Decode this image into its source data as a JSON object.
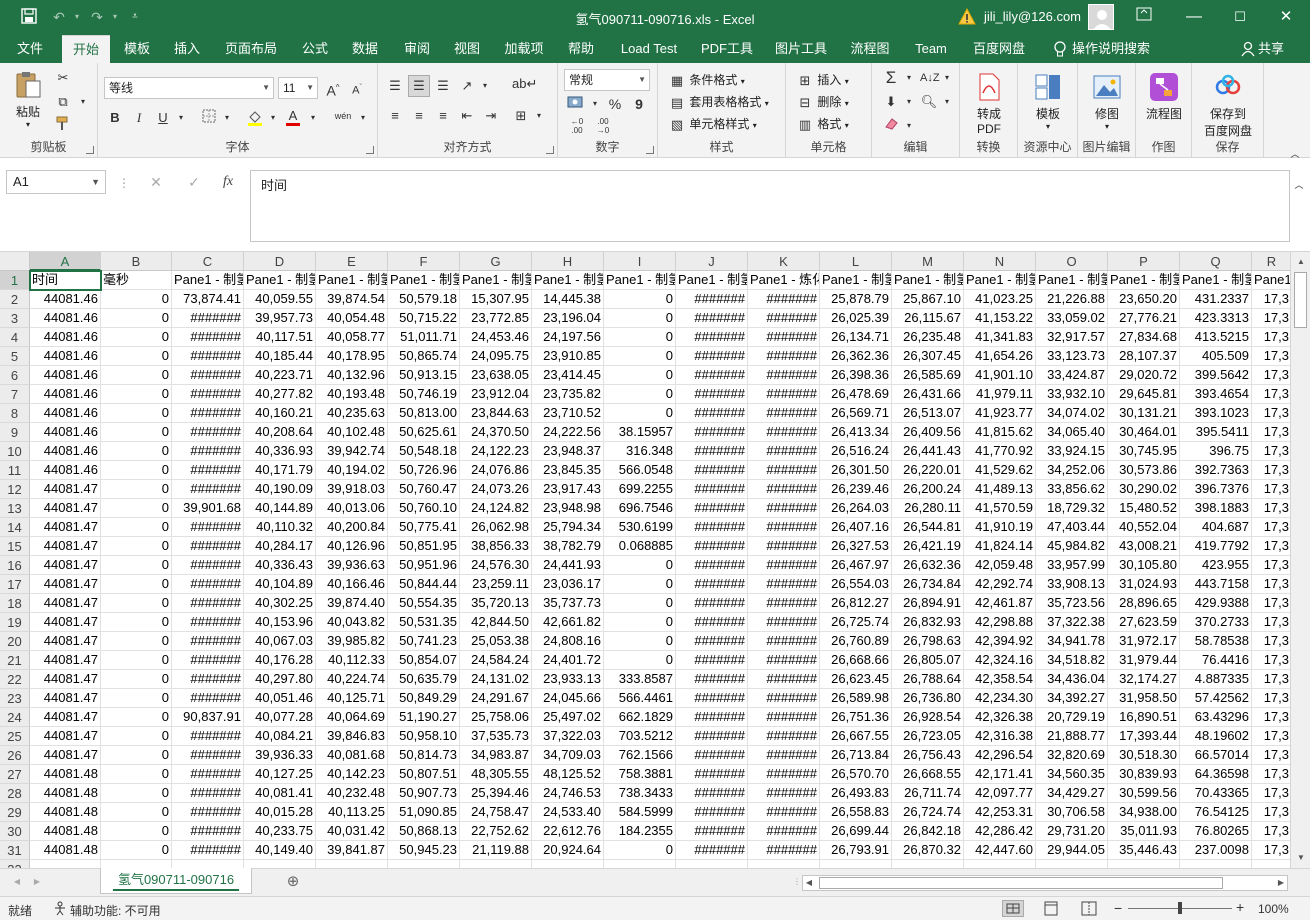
{
  "window": {
    "title": "氢气090711-090716.xls  -  Excel",
    "user": "jili_lily@126.com",
    "icons": [
      "save-icon",
      "undo-icon",
      "redo-icon",
      "customize-qat-icon",
      "warning-icon",
      "avatar",
      "minimize-icon",
      "restore-icon",
      "maximize-icon",
      "close-icon"
    ]
  },
  "tabs": [
    "文件",
    "开始",
    "模板",
    "插入",
    "页面布局",
    "公式",
    "数据",
    "审阅",
    "视图",
    "加载项",
    "帮助",
    "Load Test",
    "PDF工具",
    "图片工具",
    "流程图",
    "Team",
    "百度网盘",
    "操作说明搜索",
    "共享"
  ],
  "ribbon": {
    "clipboard": {
      "paste": "粘贴",
      "label": "剪贴板"
    },
    "font": {
      "name": "等线",
      "size": "11",
      "bold": "B",
      "italic": "I",
      "underline": "U",
      "grow": "A",
      "shrink": "A",
      "font_color": "A",
      "pinyin": "wén",
      "label": "字体"
    },
    "alignment": {
      "label": "对齐方式"
    },
    "number": {
      "format": "常规",
      "percent": "%",
      "comma": "9",
      "label": "数字"
    },
    "styles": {
      "conditional": "条件格式",
      "table": "套用表格格式",
      "cell": "单元格样式",
      "label": "样式"
    },
    "cells": {
      "insert": "插入",
      "delete": "删除",
      "format": "格式",
      "label": "单元格"
    },
    "editing": {
      "label": "编辑"
    },
    "pdf": {
      "btn": "转成\nPDF",
      "btn1": "转成",
      "btn2": "PDF",
      "label": "转换"
    },
    "template": {
      "btn": "模板",
      "label": "资源中心"
    },
    "image": {
      "btn": "修图",
      "label": "图片编辑"
    },
    "flow": {
      "btn": "流程图",
      "label": "作图"
    },
    "save": {
      "btn1": "保存到",
      "btn2": "百度网盘",
      "label": "保存"
    }
  },
  "formula_bar": {
    "namebox": "A1",
    "cancel": "✕",
    "enter": "✓",
    "fx": "fx",
    "content": "时间"
  },
  "columns": [
    "A",
    "B",
    "C",
    "D",
    "E",
    "F",
    "G",
    "H",
    "I",
    "J",
    "K",
    "L",
    "M",
    "N",
    "O",
    "P",
    "Q",
    "R"
  ],
  "header_row": [
    "时间",
    "毫秒",
    "Pane1 - 制氢",
    "Pane1 - 制氢",
    "Pane1 - 制氢",
    "Pane1 - 制氢",
    "Pane1 - 制氢",
    "Pane1 - 制氢",
    "Pane1 - 制氢",
    "Pane1 - 制氢",
    "Pane1 - 炼化",
    "Pane1 - 制氢",
    "Pane1 - 制氢",
    "Pane1 - 制氢",
    "Pane1 - 制氢",
    "Pane1 - 制氢",
    "Pane1 - 制氢",
    "Pane1"
  ],
  "rows": [
    [
      "44081.46",
      "0",
      "73,874.41",
      "40,059.55",
      "39,874.54",
      "50,579.18",
      "15,307.95",
      "14,445.38",
      "0",
      "#######",
      "#######",
      "25,878.79",
      "25,867.10",
      "41,023.25",
      "21,226.88",
      "23,650.20",
      "431.2337",
      "17,3"
    ],
    [
      "44081.46",
      "0",
      "#######",
      "39,957.73",
      "40,054.48",
      "50,715.22",
      "23,772.85",
      "23,196.04",
      "0",
      "#######",
      "#######",
      "26,025.39",
      "26,115.67",
      "41,153.22",
      "33,059.02",
      "27,776.21",
      "423.3313",
      "17,3"
    ],
    [
      "44081.46",
      "0",
      "#######",
      "40,117.51",
      "40,058.77",
      "51,011.71",
      "24,453.46",
      "24,197.56",
      "0",
      "#######",
      "#######",
      "26,134.71",
      "26,235.48",
      "41,341.83",
      "32,917.57",
      "27,834.68",
      "413.5215",
      "17,3"
    ],
    [
      "44081.46",
      "0",
      "#######",
      "40,185.44",
      "40,178.95",
      "50,865.74",
      "24,095.75",
      "23,910.85",
      "0",
      "#######",
      "#######",
      "26,362.36",
      "26,307.45",
      "41,654.26",
      "33,123.73",
      "28,107.37",
      "405.509",
      "17,3"
    ],
    [
      "44081.46",
      "0",
      "#######",
      "40,223.71",
      "40,132.96",
      "50,913.15",
      "23,638.05",
      "23,414.45",
      "0",
      "#######",
      "#######",
      "26,398.36",
      "26,585.69",
      "41,901.10",
      "33,424.87",
      "29,020.72",
      "399.5642",
      "17,3"
    ],
    [
      "44081.46",
      "0",
      "#######",
      "40,277.82",
      "40,193.48",
      "50,746.19",
      "23,912.04",
      "23,735.82",
      "0",
      "#######",
      "#######",
      "26,478.69",
      "26,431.66",
      "41,979.11",
      "33,932.10",
      "29,645.81",
      "393.4654",
      "17,3"
    ],
    [
      "44081.46",
      "0",
      "#######",
      "40,160.21",
      "40,235.63",
      "50,813.00",
      "23,844.63",
      "23,710.52",
      "0",
      "#######",
      "#######",
      "26,569.71",
      "26,513.07",
      "41,923.77",
      "34,074.02",
      "30,131.21",
      "393.1023",
      "17,3"
    ],
    [
      "44081.46",
      "0",
      "#######",
      "40,208.64",
      "40,102.48",
      "50,625.61",
      "24,370.50",
      "24,222.56",
      "38.15957",
      "#######",
      "#######",
      "26,413.34",
      "26,409.56",
      "41,815.62",
      "34,065.40",
      "30,464.01",
      "395.5411",
      "17,3"
    ],
    [
      "44081.46",
      "0",
      "#######",
      "40,336.93",
      "39,942.74",
      "50,548.18",
      "24,122.23",
      "23,948.37",
      "316.348",
      "#######",
      "#######",
      "26,516.24",
      "26,441.43",
      "41,770.92",
      "33,924.15",
      "30,745.95",
      "396.75",
      "17,3"
    ],
    [
      "44081.46",
      "0",
      "#######",
      "40,171.79",
      "40,194.02",
      "50,726.96",
      "24,076.86",
      "23,845.35",
      "566.0548",
      "#######",
      "#######",
      "26,301.50",
      "26,220.01",
      "41,529.62",
      "34,252.06",
      "30,573.86",
      "392.7363",
      "17,3"
    ],
    [
      "44081.47",
      "0",
      "#######",
      "40,190.09",
      "39,918.03",
      "50,760.47",
      "24,073.26",
      "23,917.43",
      "699.2255",
      "#######",
      "#######",
      "26,239.46",
      "26,200.24",
      "41,489.13",
      "33,856.62",
      "30,290.02",
      "396.7376",
      "17,3"
    ],
    [
      "44081.47",
      "0",
      "39,901.68",
      "40,144.89",
      "40,013.06",
      "50,760.10",
      "24,124.82",
      "23,948.98",
      "696.7546",
      "#######",
      "#######",
      "26,264.03",
      "26,280.11",
      "41,570.59",
      "18,729.32",
      "15,480.52",
      "398.1883",
      "17,3"
    ],
    [
      "44081.47",
      "0",
      "#######",
      "40,110.32",
      "40,200.84",
      "50,775.41",
      "26,062.98",
      "25,794.34",
      "530.6199",
      "#######",
      "#######",
      "26,407.16",
      "26,544.81",
      "41,910.19",
      "47,403.44",
      "40,552.04",
      "404.687",
      "17,3"
    ],
    [
      "44081.47",
      "0",
      "#######",
      "40,284.17",
      "40,126.96",
      "50,851.95",
      "38,856.33",
      "38,782.79",
      "0.068885",
      "#######",
      "#######",
      "26,327.53",
      "26,421.19",
      "41,824.14",
      "45,984.82",
      "43,008.21",
      "419.7792",
      "17,3"
    ],
    [
      "44081.47",
      "0",
      "#######",
      "40,336.43",
      "39,936.63",
      "50,951.96",
      "24,576.30",
      "24,441.93",
      "0",
      "#######",
      "#######",
      "26,467.97",
      "26,632.36",
      "42,059.48",
      "33,957.99",
      "30,105.80",
      "423.955",
      "17,3"
    ],
    [
      "44081.47",
      "0",
      "#######",
      "40,104.89",
      "40,166.46",
      "50,844.44",
      "23,259.11",
      "23,036.17",
      "0",
      "#######",
      "#######",
      "26,554.03",
      "26,734.84",
      "42,292.74",
      "33,908.13",
      "31,024.93",
      "443.7158",
      "17,3"
    ],
    [
      "44081.47",
      "0",
      "#######",
      "40,302.25",
      "39,874.40",
      "50,554.35",
      "35,720.13",
      "35,737.73",
      "0",
      "#######",
      "#######",
      "26,812.27",
      "26,894.91",
      "42,461.87",
      "35,723.56",
      "28,896.65",
      "429.9388",
      "17,3"
    ],
    [
      "44081.47",
      "0",
      "#######",
      "40,153.96",
      "40,043.82",
      "50,531.35",
      "42,844.50",
      "42,661.82",
      "0",
      "#######",
      "#######",
      "26,725.74",
      "26,832.93",
      "42,298.88",
      "37,322.38",
      "27,623.59",
      "370.2733",
      "17,3"
    ],
    [
      "44081.47",
      "0",
      "#######",
      "40,067.03",
      "39,985.82",
      "50,741.23",
      "25,053.38",
      "24,808.16",
      "0",
      "#######",
      "#######",
      "26,760.89",
      "26,798.63",
      "42,394.92",
      "34,941.78",
      "31,972.17",
      "58.78538",
      "17,3"
    ],
    [
      "44081.47",
      "0",
      "#######",
      "40,176.28",
      "40,112.33",
      "50,854.07",
      "24,584.24",
      "24,401.72",
      "0",
      "#######",
      "#######",
      "26,668.66",
      "26,805.07",
      "42,324.16",
      "34,518.82",
      "31,979.44",
      "76.4416",
      "17,3"
    ],
    [
      "44081.47",
      "0",
      "#######",
      "40,297.80",
      "40,224.74",
      "50,635.79",
      "24,131.02",
      "23,933.13",
      "333.8587",
      "#######",
      "#######",
      "26,623.45",
      "26,788.64",
      "42,358.54",
      "34,436.04",
      "32,174.27",
      "4.887335",
      "17,3"
    ],
    [
      "44081.47",
      "0",
      "#######",
      "40,051.46",
      "40,125.71",
      "50,849.29",
      "24,291.67",
      "24,045.66",
      "566.4461",
      "#######",
      "#######",
      "26,589.98",
      "26,736.80",
      "42,234.30",
      "34,392.27",
      "31,958.50",
      "57.42562",
      "17,3"
    ],
    [
      "44081.47",
      "0",
      "90,837.91",
      "40,077.28",
      "40,064.69",
      "51,190.27",
      "25,758.06",
      "25,497.02",
      "662.1829",
      "#######",
      "#######",
      "26,751.36",
      "26,928.54",
      "42,326.38",
      "20,729.19",
      "16,890.51",
      "63.43296",
      "17,3"
    ],
    [
      "44081.47",
      "0",
      "#######",
      "40,084.21",
      "39,846.83",
      "50,958.10",
      "37,535.73",
      "37,322.03",
      "703.5212",
      "#######",
      "#######",
      "26,667.55",
      "26,723.05",
      "42,316.38",
      "21,888.77",
      "17,393.44",
      "48.19602",
      "17,3"
    ],
    [
      "44081.47",
      "0",
      "#######",
      "39,936.33",
      "40,081.68",
      "50,814.73",
      "34,983.87",
      "34,709.03",
      "762.1566",
      "#######",
      "#######",
      "26,713.84",
      "26,756.43",
      "42,296.54",
      "32,820.69",
      "30,518.30",
      "66.57014",
      "17,3"
    ],
    [
      "44081.48",
      "0",
      "#######",
      "40,127.25",
      "40,142.23",
      "50,807.51",
      "48,305.55",
      "48,125.52",
      "758.3881",
      "#######",
      "#######",
      "26,570.70",
      "26,668.55",
      "42,171.41",
      "34,560.35",
      "30,839.93",
      "64.36598",
      "17,3"
    ],
    [
      "44081.48",
      "0",
      "#######",
      "40,081.41",
      "40,232.48",
      "50,907.73",
      "25,394.46",
      "24,746.53",
      "738.3433",
      "#######",
      "#######",
      "26,493.83",
      "26,711.74",
      "42,097.77",
      "34,429.27",
      "30,599.56",
      "70.43365",
      "17,3"
    ],
    [
      "44081.48",
      "0",
      "#######",
      "40,015.28",
      "40,113.25",
      "51,090.85",
      "24,758.47",
      "24,533.40",
      "584.5999",
      "#######",
      "#######",
      "26,558.83",
      "26,724.74",
      "42,253.31",
      "30,706.58",
      "34,938.00",
      "76.54125",
      "17,3"
    ],
    [
      "44081.48",
      "0",
      "#######",
      "40,233.75",
      "40,031.42",
      "50,868.13",
      "22,752.62",
      "22,612.76",
      "184.2355",
      "#######",
      "#######",
      "26,699.44",
      "26,842.18",
      "42,286.42",
      "29,731.20",
      "35,011.93",
      "76.80265",
      "17,3"
    ],
    [
      "44081.48",
      "0",
      "#######",
      "40,149.40",
      "39,841.87",
      "50,945.23",
      "21,119.88",
      "20,924.64",
      "0",
      "#######",
      "#######",
      "26,793.91",
      "26,870.32",
      "42,447.60",
      "29,944.05",
      "35,446.43",
      "237.0098",
      "17,3"
    ]
  ],
  "sheet_tab": "氢气090711-090716",
  "status": {
    "ready": "就绪",
    "accessibility": "辅助功能: 不可用",
    "zoom": "100%"
  }
}
